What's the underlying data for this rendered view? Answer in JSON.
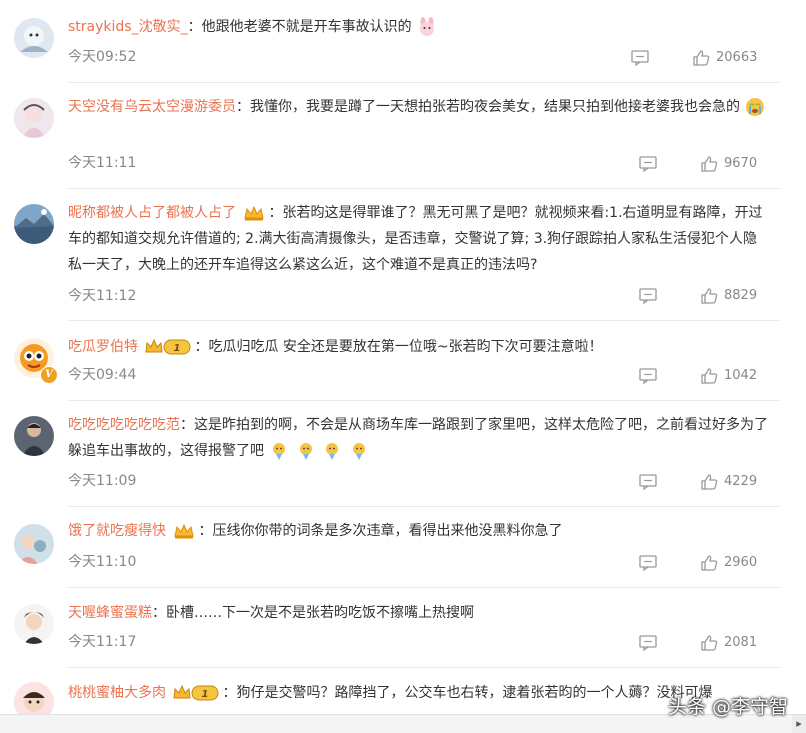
{
  "comments": [
    {
      "user": "straykids_沈敬实_",
      "body": "他跟他老婆不就是开车事故认识的",
      "time": "今天09:52",
      "likes": "20663"
    },
    {
      "user": "天空没有乌云太空漫游委员",
      "body": "我懂你，我要是蹲了一天想拍张若昀夜会美女，结果只拍到他接老婆我也会急的",
      "time": "今天11:11",
      "likes": "9670"
    },
    {
      "user": "昵称都被人占了都被人占了",
      "body": "张若昀这是得罪谁了？黑无可黑了是吧？就视频来看:1.右道明显有路障，开过车的都知道交规允许借道的; 2.满大街高清摄像头，是否违章，交警说了算; 3.狗仔跟踪拍人家私生活侵犯个人隐私一天了，大晚上的还开车追得这么紧这么近，这个难道不是真正的违法吗?",
      "time": "今天11:12",
      "likes": "8829"
    },
    {
      "user": "吃瓜罗伯特",
      "body": "吃瓜归吃瓜 安全还是要放在第一位哦~张若昀下次可要注意啦！",
      "time": "今天09:44",
      "likes": "1042"
    },
    {
      "user": "吃吃吃吃吃吃吃范",
      "body": "这是昨拍到的啊，不会是从商场车库一路跟到了家里吧，这样太危险了吧，之前看过好多为了躲追车出事故的，这得报警了吧",
      "time": "今天11:09",
      "likes": "4229"
    },
    {
      "user": "饿了就吃瘦得快",
      "body": "压线你你带的词条是多次违章，看得出来他没黑料你急了",
      "time": "今天11:10",
      "likes": "2960"
    },
    {
      "user": "天喔蜂蜜蛋糕",
      "body": "卧槽……下一次是不是张若昀吃饭不擦嘴上热搜啊",
      "time": "今天11:17",
      "likes": "2081"
    },
    {
      "user": "桃桃蜜柚大多肉",
      "body": "狗仔是交警吗？路障挡了，公交车也右转，逮着张若昀的一个人薅？没料可爆",
      "time": "",
      "likes": ""
    }
  ],
  "level_badge": "1",
  "verified_badge": "V",
  "separator": "：",
  "watermark": "头条 @李守智",
  "colors": {
    "username": "#eb7350",
    "text": "#333333",
    "meta": "#888888"
  }
}
